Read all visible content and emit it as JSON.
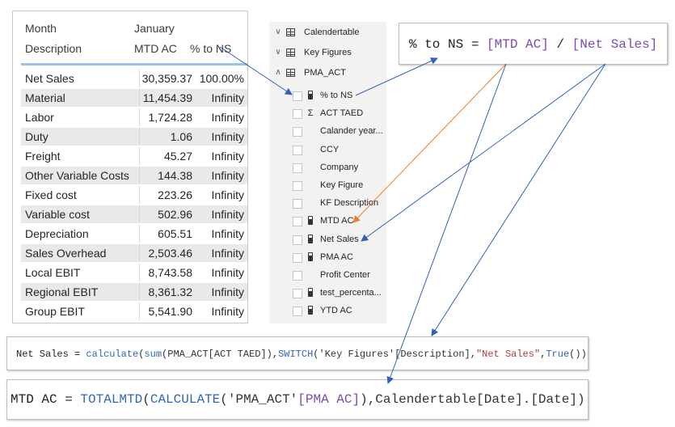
{
  "matrix": {
    "header": {
      "row_label_top": "Month",
      "row_label_bottom": "Description",
      "col_group": "January",
      "col1": "MTD AC",
      "col2": "% to NS"
    },
    "rows": [
      {
        "desc": "Net Sales",
        "mtd": "30,359.37",
        "pct": "100.00%"
      },
      {
        "desc": "Material",
        "mtd": "11,454.39",
        "pct": "Infinity"
      },
      {
        "desc": "Labor",
        "mtd": "1,724.28",
        "pct": "Infinity"
      },
      {
        "desc": "Duty",
        "mtd": "1.06",
        "pct": "Infinity"
      },
      {
        "desc": "Freight",
        "mtd": "45.27",
        "pct": "Infinity"
      },
      {
        "desc": "Other Variable Costs",
        "mtd": "144.38",
        "pct": "Infinity"
      },
      {
        "desc": "Fixed cost",
        "mtd": "223.26",
        "pct": "Infinity"
      },
      {
        "desc": "Variable cost",
        "mtd": "502.96",
        "pct": "Infinity"
      },
      {
        "desc": "Depreciation",
        "mtd": "605.51",
        "pct": "Infinity"
      },
      {
        "desc": "Sales Overhead",
        "mtd": "2,503.46",
        "pct": "Infinity"
      },
      {
        "desc": "Local EBIT",
        "mtd": "8,743.58",
        "pct": "Infinity"
      },
      {
        "desc": "Regional EBIT",
        "mtd": "8,361.32",
        "pct": "Infinity"
      },
      {
        "desc": "Group EBIT",
        "mtd": "5,541.90",
        "pct": "Infinity"
      }
    ]
  },
  "fields": {
    "groups": [
      {
        "name": "Calendertable",
        "chevron": "∨"
      },
      {
        "name": "Key Figures",
        "chevron": "∨"
      },
      {
        "name": "PMA_ACT",
        "chevron": "∧"
      }
    ],
    "items": [
      {
        "name": "% to NS",
        "icon": "calc-icon"
      },
      {
        "name": "ACT TAED",
        "icon": "sigma-icon",
        "glyph": "Σ"
      },
      {
        "name": "Calander year...",
        "icon": "none"
      },
      {
        "name": "CCY",
        "icon": "none"
      },
      {
        "name": "Company",
        "icon": "none"
      },
      {
        "name": "Key Figure",
        "icon": "none"
      },
      {
        "name": "KF Description",
        "icon": "none"
      },
      {
        "name": "MTD AC",
        "icon": "calc-icon"
      },
      {
        "name": "Net Sales",
        "icon": "calc-icon"
      },
      {
        "name": "PMA AC",
        "icon": "calc-icon"
      },
      {
        "name": "Profit Center",
        "icon": "none"
      },
      {
        "name": "test_percenta...",
        "icon": "calc-icon"
      },
      {
        "name": "YTD AC",
        "icon": "calc-icon"
      }
    ]
  },
  "formulas": {
    "pct_to_ns": {
      "name": "% to NS",
      "eq": " = ",
      "ref1": "[MTD AC]",
      "op": " / ",
      "ref2": "[Net Sales]"
    },
    "net_sales": {
      "name": "Net Sales",
      "eq": " = ",
      "fn1": "calculate",
      "p1": "(",
      "fn2": "sum",
      "arg1": "(PMA_ACT[ACT TAED]),",
      "fn3": "SWITCH",
      "arg2": "('Key Figures'[Description],",
      "str": "\"Net Sales\"",
      "arg3": ",",
      "fn4": "True",
      "close": "()))"
    },
    "mtd_ac": {
      "name": "MTD AC",
      "eq": " = ",
      "fn1": "TOTALMTD",
      "p1": "(",
      "fn2": "CALCULATE",
      "arg1": "('PMA_ACT'",
      "ref": "[PMA AC]",
      "arg2": "),Calendertable[Date].[Date])"
    }
  },
  "colors": {
    "arrow_blue": "#2f62b8",
    "arrow_orange": "#ed7d31",
    "matrix_header_line": "#9cc3e5",
    "function_blue": "#3165bb",
    "reference_purple": "#7a4ab0",
    "string_red": "#b23b3b"
  }
}
